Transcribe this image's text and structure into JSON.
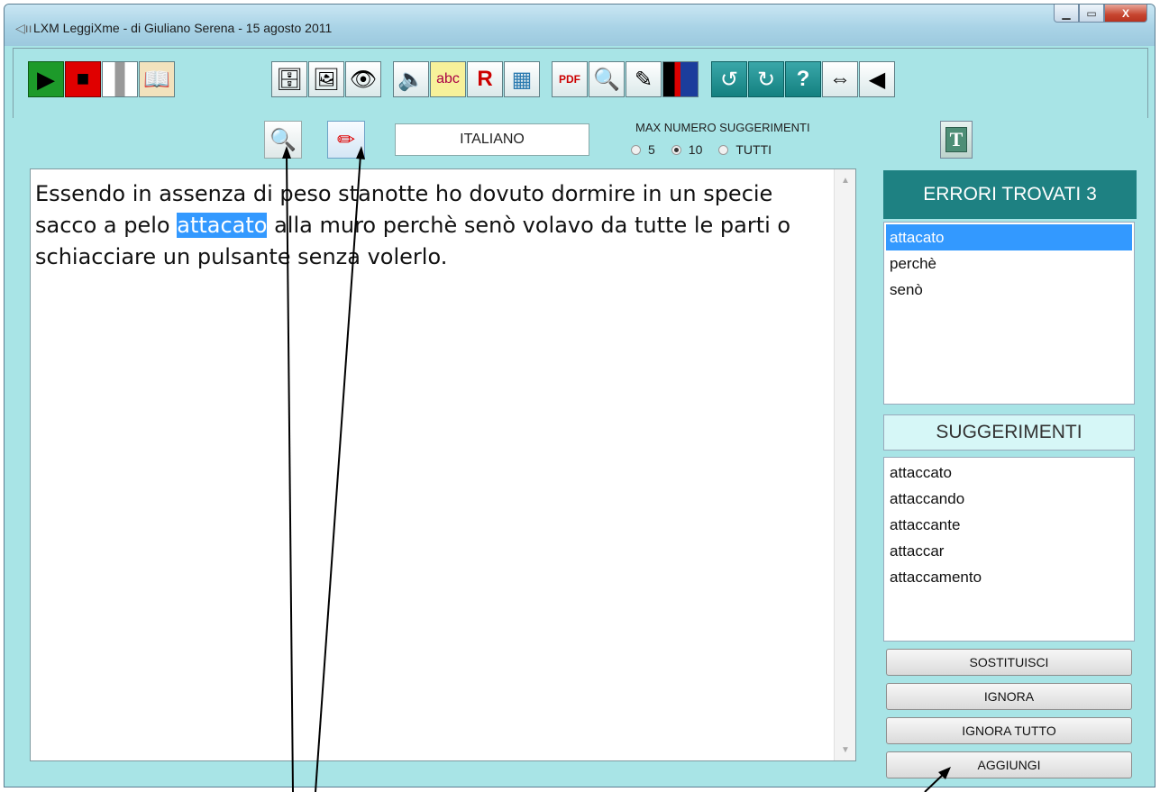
{
  "window": {
    "title": "LXM  LeggiXme - di Giuliano Serena - 15 agosto 2011",
    "title_icon": "speaker-icon",
    "controls": [
      "minimize",
      "maximize",
      "close"
    ]
  },
  "toolbar": {
    "buttons": [
      {
        "name": "play",
        "icon": "▶",
        "color": "#00aa00"
      },
      {
        "name": "stop",
        "icon": "■",
        "color": "#dd0000"
      },
      {
        "name": "pause",
        "icon": "❚❚",
        "color": "#bbbbbb"
      },
      {
        "name": "book",
        "icon": "📖"
      },
      {
        "name": "file-cabinet",
        "icon": "🗄"
      },
      {
        "name": "capture",
        "icon": "🖼"
      },
      {
        "name": "eye",
        "icon": "👁"
      },
      {
        "name": "speaker",
        "icon": "🔈"
      },
      {
        "name": "spellcheck",
        "icon": "abc"
      },
      {
        "name": "dictionary",
        "icon": "R"
      },
      {
        "name": "calendar",
        "icon": "▦"
      },
      {
        "name": "pdf",
        "icon": "PDF"
      },
      {
        "name": "search",
        "icon": "🔍"
      },
      {
        "name": "notepad",
        "icon": "✎"
      },
      {
        "name": "translate",
        "icon": "⚑"
      },
      {
        "name": "undo",
        "icon": "↺"
      },
      {
        "name": "redo",
        "icon": "↻"
      },
      {
        "name": "help",
        "icon": "?"
      },
      {
        "name": "swap",
        "icon": "⇔"
      },
      {
        "name": "back",
        "icon": "◀"
      }
    ]
  },
  "controls": {
    "language": "ITALIANO",
    "max_label": "MAX NUMERO SUGGERIMENTI",
    "radio_options": [
      "5",
      "10",
      "TUTTI"
    ],
    "selected_option": "10",
    "search_icon": "magnifier-icon",
    "pen_icon": "pen-icon",
    "t_label": "T"
  },
  "editor": {
    "before": "Essendo in assenza di peso stanotte ho dovuto dormire in un specie sacco a pelo ",
    "highlight": "attacato",
    "after": " alla muro perchè senò volavo da tutte le parti o schiacciare un pulsante senza volerlo."
  },
  "errors": {
    "header": "ERRORI TROVATI 3",
    "items": [
      "attacato",
      "perchè",
      "senò"
    ],
    "selected_index": 0
  },
  "suggestions": {
    "header": "SUGGERIMENTI",
    "items": [
      "attaccato",
      "attaccando",
      "attaccante",
      "attaccar",
      "attaccamento"
    ]
  },
  "actions": {
    "replace": "SOSTITUISCI",
    "ignore": "IGNORA",
    "ignore_all": "IGNORA TUTTO",
    "add": "AGGIUNGI"
  }
}
